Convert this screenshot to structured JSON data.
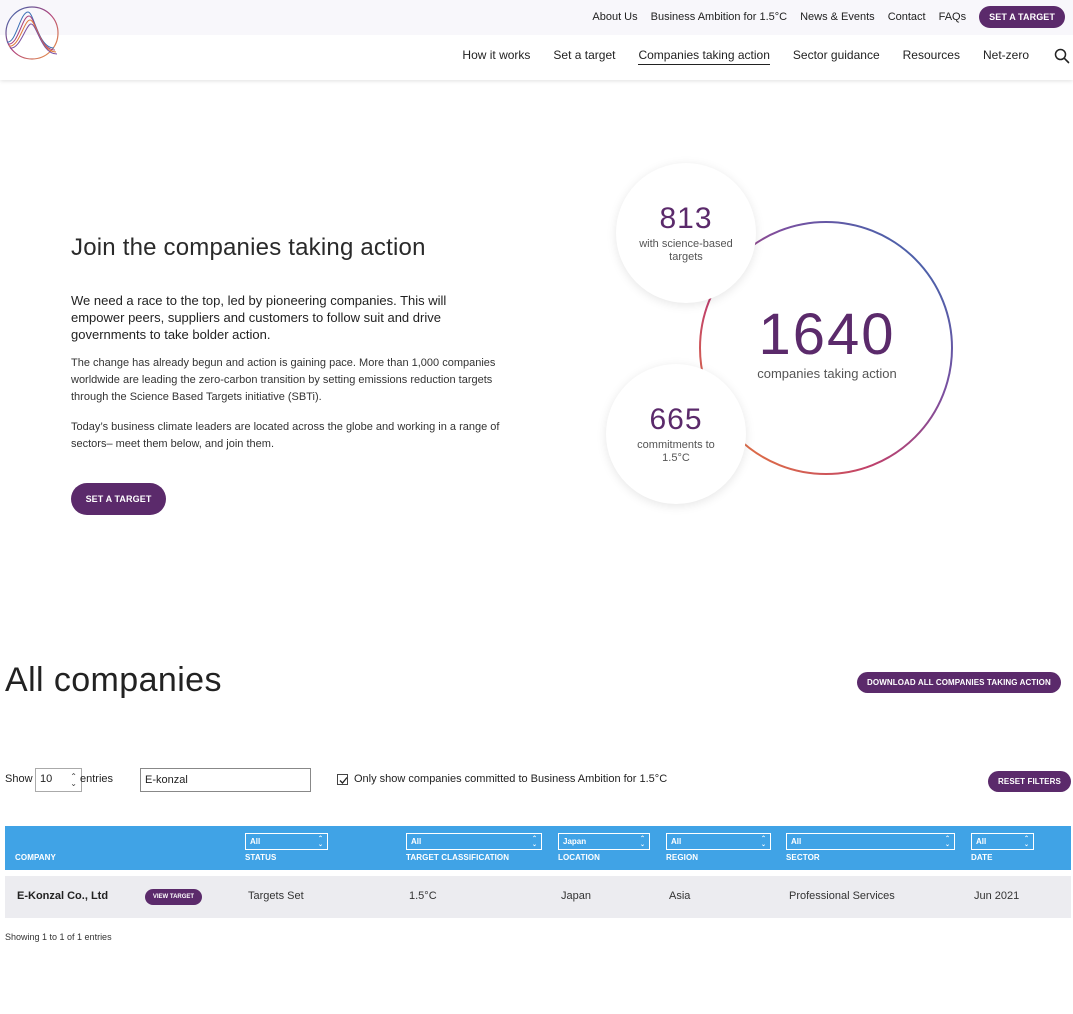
{
  "header": {
    "top_links": [
      "About Us",
      "Business Ambition for 1.5°C",
      "News & Events",
      "Contact",
      "FAQs"
    ],
    "cta_label": "SET A TARGET",
    "nav": [
      "How it works",
      "Set a target",
      "Companies taking action",
      "Sector guidance",
      "Resources",
      "Net-zero"
    ],
    "active_nav": "Companies taking action"
  },
  "hero": {
    "title": "Join the companies taking action",
    "lead": "We need a race to the top, led by pioneering companies. This will empower peers, suppliers and customers to follow suit and drive governments to take bolder action.",
    "paragraph_1": "The change has already begun and action is gaining pace. More than 1,000 companies worldwide are leading the zero-carbon transition by setting emissions reduction targets through the Science Based Targets initiative (SBTi).",
    "paragraph_2": "Today’s business climate leaders are located across the globe and working in a range of sectors– meet them below, and join them.",
    "button_label": "SET A TARGET"
  },
  "stats": {
    "science_based": {
      "value": "813",
      "label": "with science-based targets"
    },
    "total": {
      "value": "1640",
      "label": "companies taking action"
    },
    "commitments": {
      "value": "665",
      "label": "commitments to 1.5°C"
    }
  },
  "companies": {
    "title": "All companies",
    "download_label": "DOWNLOAD ALL COMPANIES TAKING ACTION",
    "show_label": "Show",
    "show_value": "10",
    "entries_label": "entries",
    "search_value": "E-konzal",
    "checkbox_label": "Only show companies committed to Business Ambition for 1.5°C",
    "checkbox_checked": true,
    "reset_label": "RESET FILTERS",
    "columns": [
      "COMPANY",
      "STATUS",
      "TARGET CLASSIFICATION",
      "LOCATION",
      "REGION",
      "SECTOR",
      "DATE"
    ],
    "filters": {
      "status": "All",
      "target_classification": "All",
      "location": "Japan",
      "region": "All",
      "sector": "All",
      "date": "All"
    },
    "rows": [
      {
        "company": "E-Konzal Co., Ltd",
        "action_label": "VIEW TARGET",
        "status": "Targets Set",
        "classification": "1.5°C",
        "location": "Japan",
        "region": "Asia",
        "sector": "Professional Services",
        "date": "Jun 2021"
      }
    ],
    "showing_text": "Showing 1 to 1 of 1 entries"
  },
  "colors": {
    "brand_purple": "#5b2a6b",
    "table_header": "#40a3e6",
    "row_bg": "#ececf0"
  }
}
